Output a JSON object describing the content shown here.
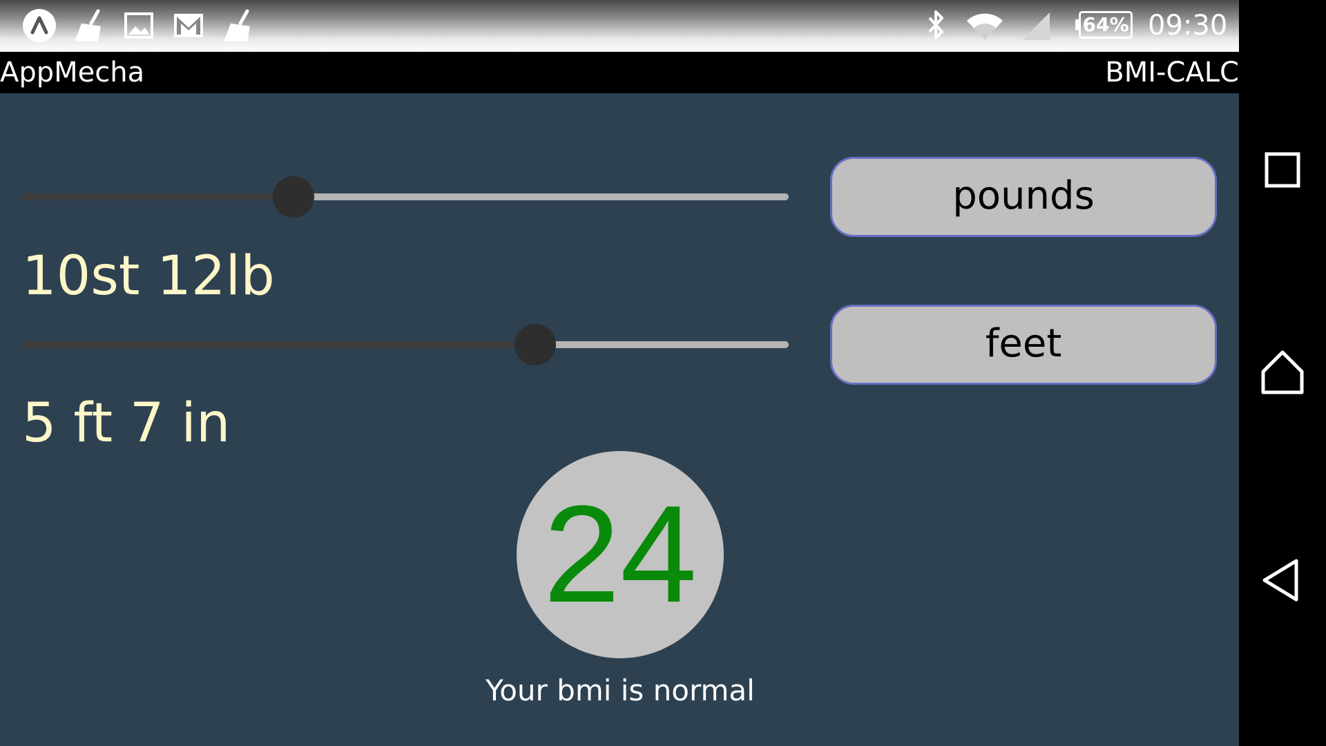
{
  "status_bar": {
    "left_icons": [
      "app-launcher-icon",
      "broom-icon",
      "image-icon",
      "gmail-icon",
      "broom-icon"
    ],
    "right_icons": [
      "bluetooth-icon",
      "wifi-icon",
      "cell-signal-icon"
    ],
    "battery": "64%",
    "time": "09:30"
  },
  "app_bar": {
    "title": "AppMecha",
    "subtitle": "BMI-CALC"
  },
  "weight": {
    "display": "10st 12lb",
    "slider_fraction": 0.355,
    "unit_button": "pounds"
  },
  "height": {
    "display": "5 ft 7 in",
    "slider_fraction": 0.67,
    "unit_button": "feet"
  },
  "result": {
    "bmi_value": "24",
    "bmi_color": "#0a8a0a",
    "message": "Your bmi is normal"
  },
  "nav_bar": {
    "buttons": [
      "recents-icon",
      "home-icon",
      "back-icon"
    ]
  },
  "colors": {
    "background": "#2d4151",
    "value_text": "#fdf6c8",
    "button_border": "#6a6fc4"
  }
}
